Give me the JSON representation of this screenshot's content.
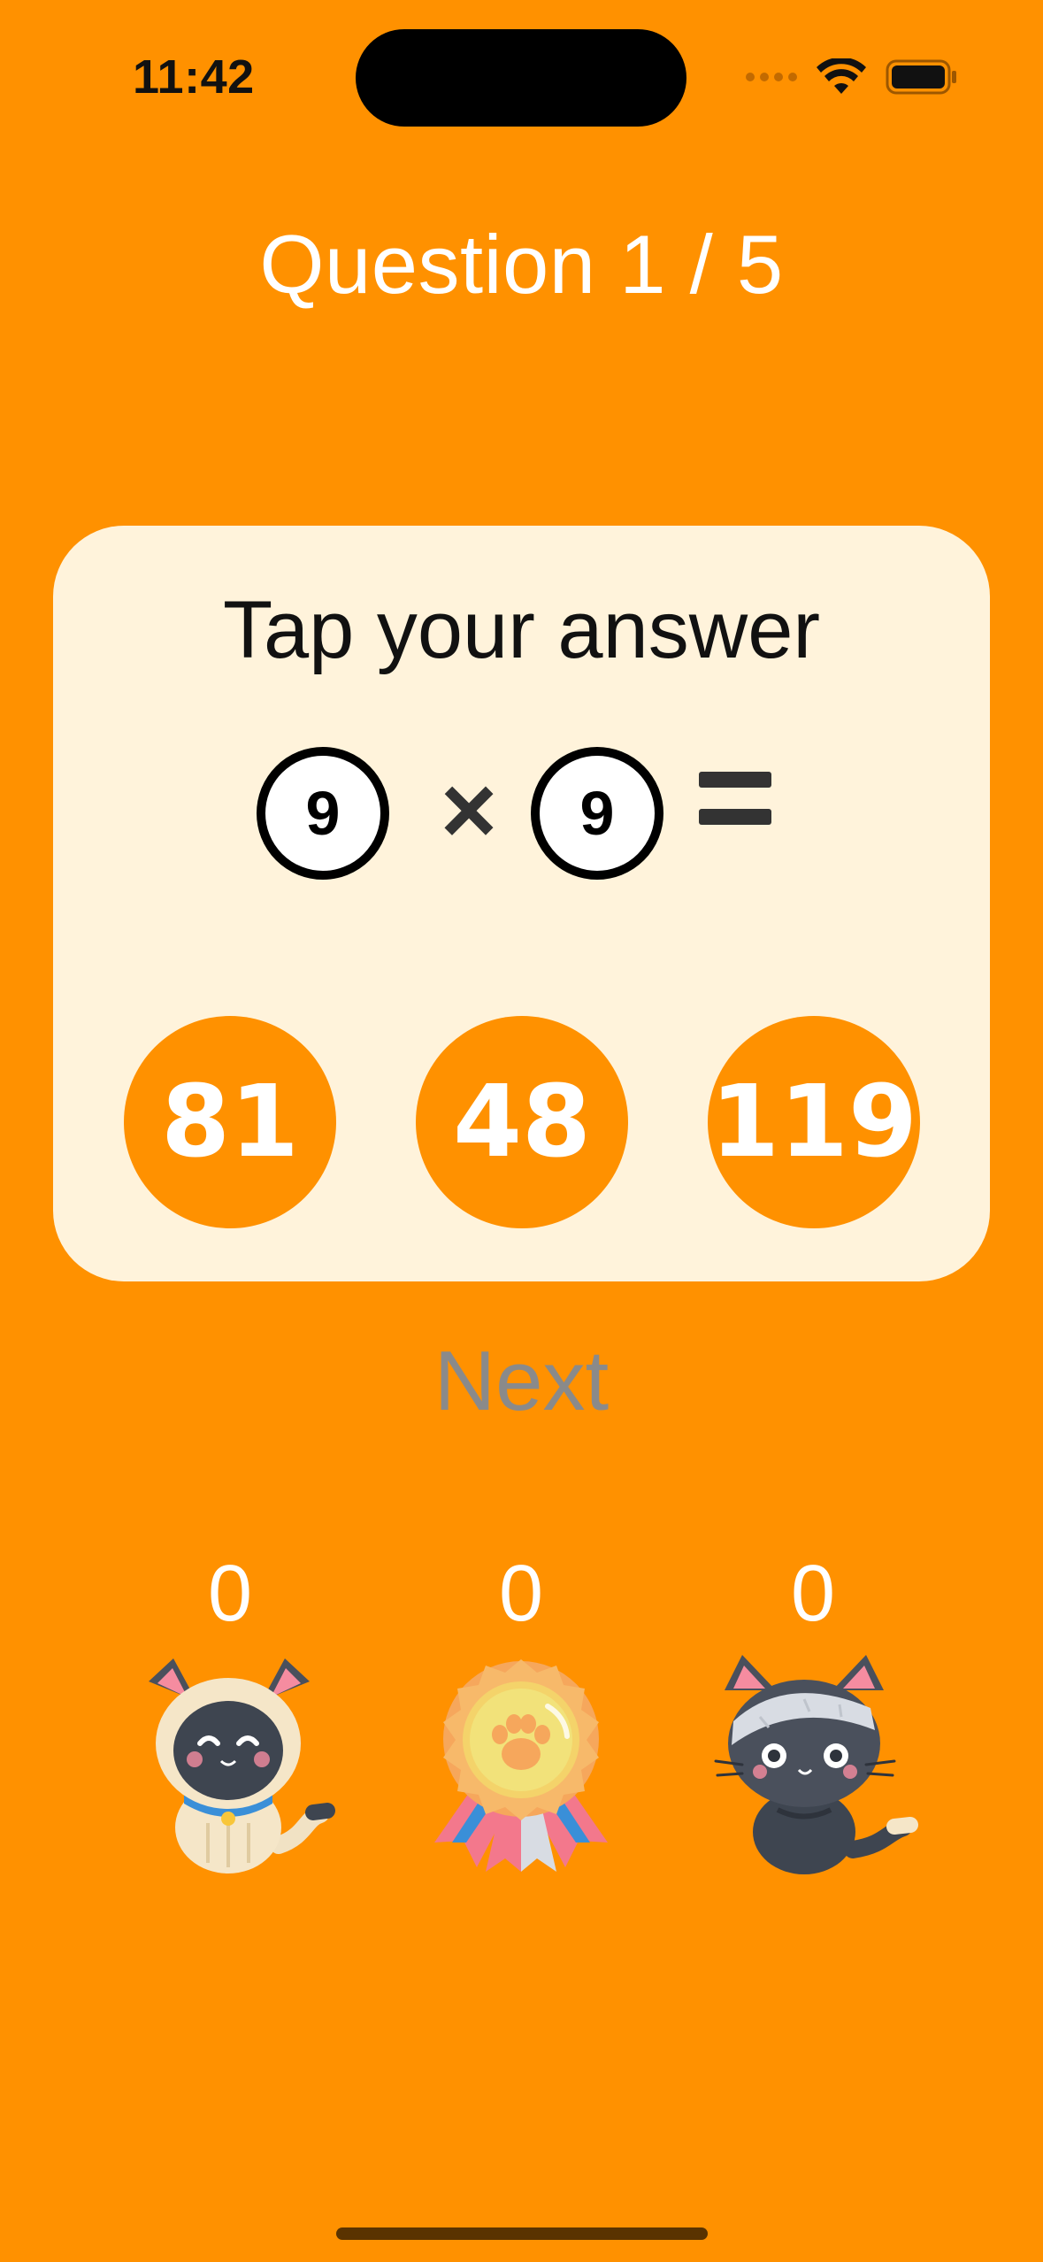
{
  "status_bar": {
    "time": "11:42"
  },
  "header": {
    "question_counter": "Question 1 / 5"
  },
  "card": {
    "title": "Tap your answer",
    "equation": {
      "left_operand": "9",
      "operator": "×",
      "right_operand": "9",
      "equals_icon": "equals-icon"
    },
    "answers": [
      "81",
      "48",
      "119"
    ]
  },
  "next_button": {
    "label": "Next"
  },
  "scores": [
    {
      "value": "0",
      "icon": "siamese-cat-icon"
    },
    {
      "value": "0",
      "icon": "paw-medal-icon"
    },
    {
      "value": "0",
      "icon": "black-cat-icon"
    }
  ],
  "colors": {
    "background": "#FF9100",
    "card": "#FFF3DB",
    "answer_button": "#FF9100",
    "next_disabled": "#8A8A8A",
    "text_light": "#FFFFFF",
    "text_dark": "#111111"
  }
}
